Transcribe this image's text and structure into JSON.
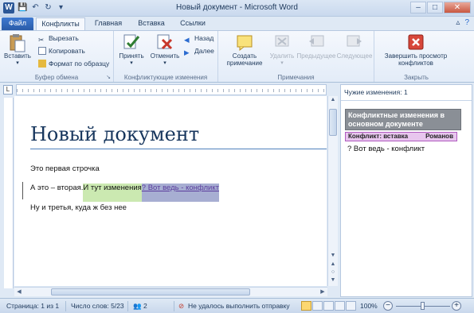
{
  "window": {
    "title": "Новый документ - Microsoft Word",
    "app_icon": "W",
    "qat": [
      "save-icon",
      "undo-icon",
      "redo-icon",
      "customize-icon"
    ]
  },
  "tabs": [
    {
      "label": "Файл",
      "kind": "file"
    },
    {
      "label": "Конфликты",
      "kind": "active"
    },
    {
      "label": "Главная",
      "kind": "normal"
    },
    {
      "label": "Вставка",
      "kind": "normal"
    },
    {
      "label": "Ссылки",
      "kind": "normal"
    }
  ],
  "ribbon": {
    "clipboard": {
      "label": "Буфер обмена",
      "paste": "Вставить",
      "cut": "Вырезать",
      "copy": "Копировать",
      "format_painter": "Формат по образцу"
    },
    "conflict_changes": {
      "label": "Конфликтующие изменения",
      "accept": "Принять",
      "reject": "Отменить",
      "back": "Назад",
      "next": "Далее"
    },
    "notes": {
      "label": "Примечания",
      "create_line1": "Создать",
      "create_line2": "примечание",
      "delete": "Удалить",
      "previous": "Предыдущее",
      "next": "Следующее"
    },
    "close": {
      "label": "Закрыть",
      "finish_line1": "Завершить просмотр",
      "finish_line2": "конфликтов"
    }
  },
  "document": {
    "title": "Новый документ",
    "para1": "Это первая строчка",
    "para2_plain": "А это – вторая.",
    "para2_green": " И тут изменения",
    "para2_conflict": " ? Вот ведь - конфликт",
    "para3": "Ну и третья, куда ж без нее"
  },
  "pane": {
    "header": "Чужие изменения: 1",
    "box_title": "Конфликтные изменения в основном документе",
    "row_type": "Конфликт: вставка",
    "row_author": "Романов",
    "conflict_text": "? Вот ведь - конфликт"
  },
  "status": {
    "page": "Страница: 1 из 1",
    "words": "Число слов: 5/23",
    "num": "2",
    "send_error": "Не удалось выполнить отправку",
    "zoom": "100%",
    "zoom_level_percent": 100
  },
  "colors": {
    "insertion_green": "#cbe9b1",
    "conflict_purple": "#a7aed2",
    "conflict_row": "#e8c6ee",
    "title_blue": "#17365d"
  }
}
